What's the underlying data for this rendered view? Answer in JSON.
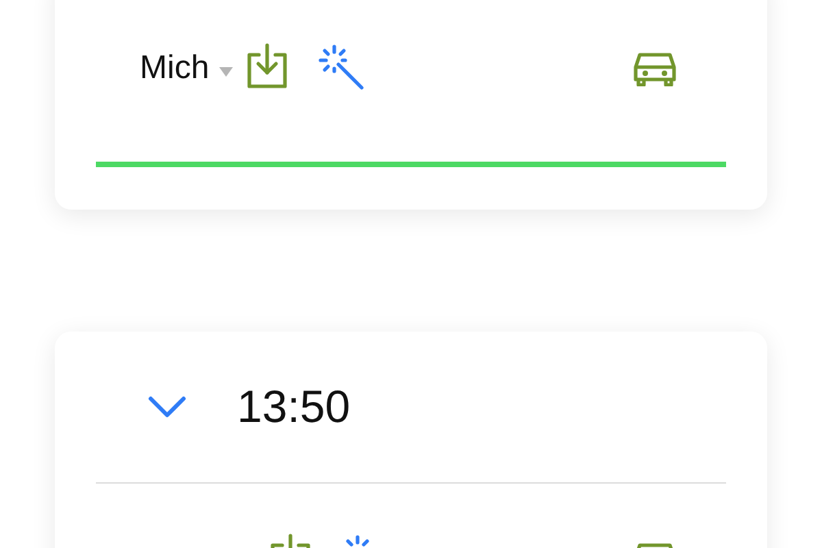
{
  "cards": [
    {
      "kind": "person",
      "name": "Mich"
    },
    {
      "kind": "time_group",
      "time": "13:50",
      "expanded": true
    }
  ]
}
